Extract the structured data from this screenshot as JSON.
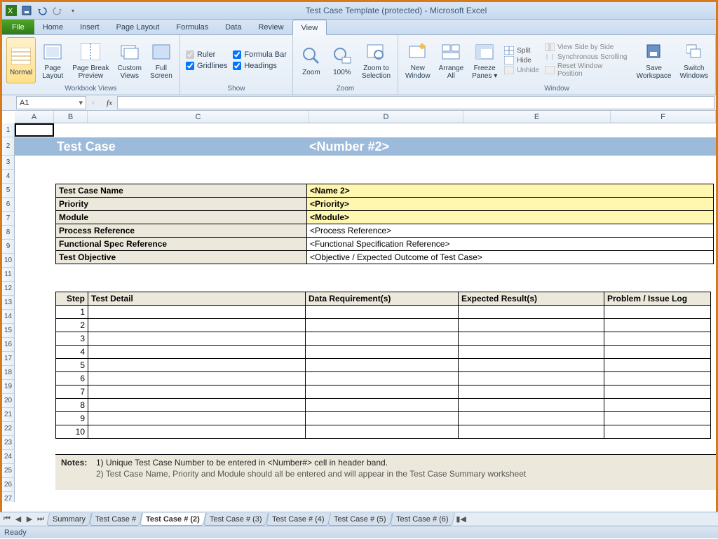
{
  "title": "Test Case Template (protected)  -  Microsoft Excel",
  "ribbon_tabs": {
    "file": "File",
    "home": "Home",
    "insert": "Insert",
    "pagelayout": "Page Layout",
    "formulas": "Formulas",
    "data": "Data",
    "review": "Review",
    "view": "View"
  },
  "ribbon": {
    "views": {
      "normal": "Normal",
      "pagelayout": "Page\nLayout",
      "pagebreak": "Page Break\nPreview",
      "custom": "Custom\nViews",
      "fullscreen": "Full\nScreen",
      "group": "Workbook Views"
    },
    "show": {
      "ruler": "Ruler",
      "formulabar": "Formula Bar",
      "gridlines": "Gridlines",
      "headings": "Headings",
      "group": "Show"
    },
    "zoom": {
      "zoom": "Zoom",
      "hundred": "100%",
      "zoomsel": "Zoom to\nSelection",
      "group": "Zoom"
    },
    "window": {
      "neww": "New\nWindow",
      "arrange": "Arrange\nAll",
      "freeze": "Freeze\nPanes ▾",
      "split": "Split",
      "hide": "Hide",
      "unhide": "Unhide",
      "sidebyside": "View Side by Side",
      "syncscroll": "Synchronous Scrolling",
      "resetpos": "Reset Window Position",
      "group": "Window"
    },
    "macros": {
      "save": "Save\nWorkspace",
      "switch": "Switch\nWindows"
    }
  },
  "namebox": "A1",
  "fx_label": "fx",
  "columns": [
    "A",
    "B",
    "C",
    "D",
    "E",
    "F"
  ],
  "rows": [
    "1",
    "2",
    "3",
    "4",
    "5",
    "6",
    "7",
    "8",
    "9",
    "10",
    "11",
    "12",
    "13",
    "14",
    "15",
    "16",
    "17",
    "18",
    "19",
    "20",
    "21",
    "22",
    "23",
    "24",
    "25",
    "26",
    "27"
  ],
  "band": {
    "title": "Test Case",
    "number": "<Number #2>"
  },
  "meta": [
    {
      "label": "Test Case Name",
      "value": "<Name 2>",
      "req": true
    },
    {
      "label": "Priority",
      "value": "<Priority>",
      "req": true
    },
    {
      "label": "Module",
      "value": "<Module>",
      "req": true
    },
    {
      "label": "Process Reference",
      "value": "<Process Reference>",
      "req": false
    },
    {
      "label": "Functional Spec Reference",
      "value": "<Functional Specification Reference>",
      "req": false
    },
    {
      "label": "Test Objective",
      "value": "<Objective / Expected Outcome of Test Case>",
      "req": false
    }
  ],
  "steps_headers": {
    "step": "Step",
    "detail": "Test Detail",
    "data": "Data Requirement(s)",
    "expected": "Expected Result(s)",
    "problem": "Problem / Issue Log"
  },
  "steps": [
    1,
    2,
    3,
    4,
    5,
    6,
    7,
    8,
    9,
    10
  ],
  "notes": {
    "label": "Notes:",
    "n1": "1) Unique Test Case Number to be entered in <Number#> cell in header band.",
    "n2": "2) Test Case Name, Priority and Module should all be entered and will appear in the Test Case Summary worksheet"
  },
  "sheet_tabs": [
    "Summary",
    "Test Case #",
    "Test Case # (2)",
    "Test Case # (3)",
    "Test Case # (4)",
    "Test Case # (5)",
    "Test Case # (6)"
  ],
  "active_sheet_tab": 2,
  "status": "Ready"
}
